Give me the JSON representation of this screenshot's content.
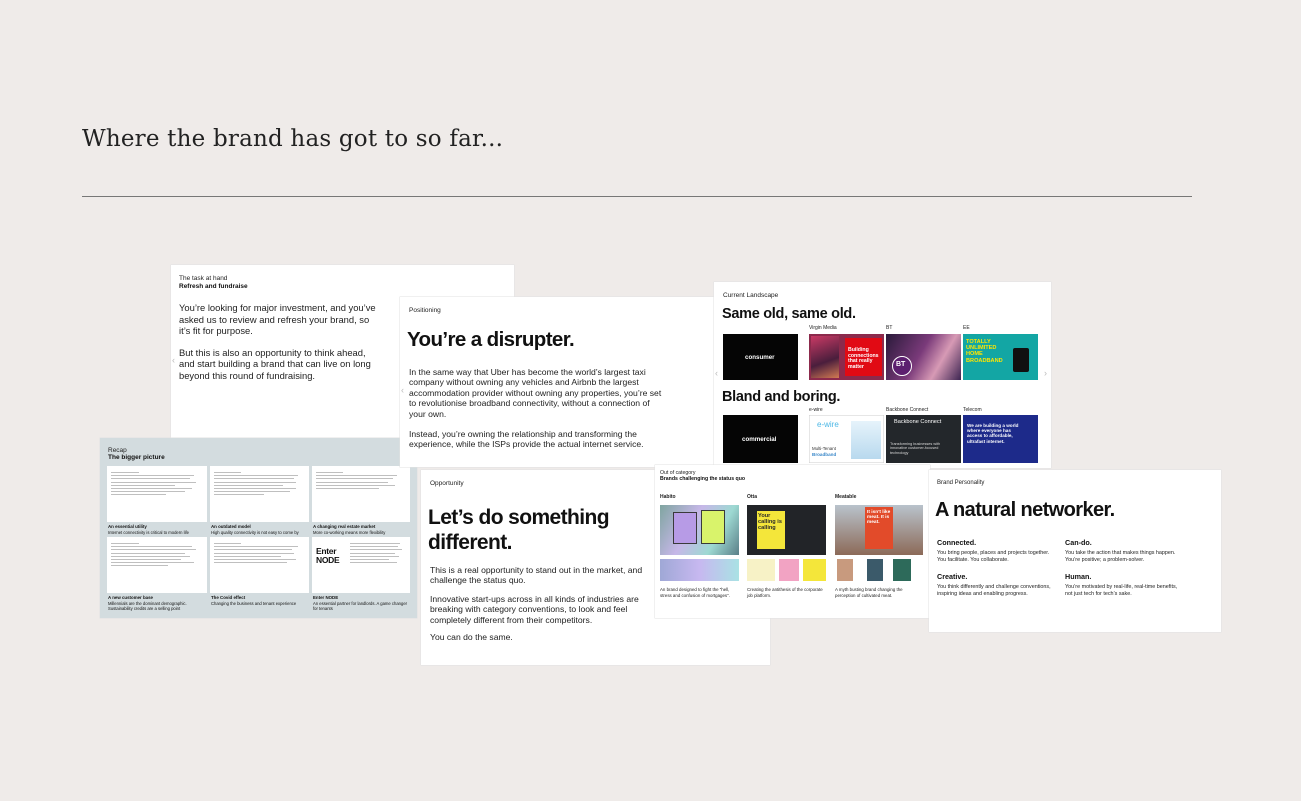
{
  "page": {
    "title": "Where the brand has got to so far..."
  },
  "slides": {
    "task": {
      "label": "The task at hand",
      "title": "Refresh and fundraise",
      "p1": "You’re looking for major investment, and you’ve asked us to review and refresh your brand, so it’s fit for purpose.",
      "p2": "But this is also an opportunity to think ahead, and start building a brand that can live on long beyond this round of fundraising."
    },
    "positioning": {
      "label": "Positioning",
      "heading": "You’re a disrupter.",
      "p1": "In the same way that Uber has become the world’s largest taxi company without owning any vehicles and Airbnb the largest accommodation provider without owning any properties, you’re set to revolutionise broadband connectivity, without a connection of your own.",
      "p2": "Instead, you’re owning the relationship and transforming the experience, while the ISPs provide the actual internet service."
    },
    "landscape": {
      "label": "Current Landscape",
      "heading1": "Same old, same old.",
      "heading2": "Bland and boring.",
      "consumer": "consumer",
      "commercial": "commercial",
      "row1": [
        "Virgin Media",
        "BT",
        "EE"
      ],
      "row2": [
        "e-wire",
        "Backbone Connect",
        "Telecom"
      ],
      "virgin_text": "Building connections that really matter",
      "bt_logo": "BT",
      "ee_text": "TOTALLY UNLIMITED HOME BROADBAND",
      "ewire_logo": "e-wire",
      "ewire_sub1": "Multi-Tenant",
      "ewire_sub2": "Broadband",
      "backbone_logo": "Backbone Connect",
      "backbone_text": "Transforming businesses with innovative customer-focused technology",
      "telecom_text": "We are building a world where everyone has access to affordable, ultrafast internet."
    },
    "recap": {
      "label": "Recap",
      "title": "The bigger picture",
      "captions": [
        {
          "title": "An essential utility",
          "text": "Internet connectivity is critical to modern life"
        },
        {
          "title": "An outdated model",
          "text": "High quality connectivity is not easy to come by"
        },
        {
          "title": "A changing real estate market",
          "text": "More co-working means more flexibility"
        },
        {
          "title": "A new customer base",
          "text": "Millennials are the dominant demographic. Sustainability credits are a selling point"
        },
        {
          "title": "The Covid effect",
          "text": "Changing the business and tenant experience"
        },
        {
          "title": "Enter NODE",
          "text": "An essential partner for landlords. A game changer for tenants"
        }
      ],
      "enter_node": "Enter NODE"
    },
    "opportunity": {
      "label": "Opportunity",
      "heading": "Let’s do something different.",
      "p1": "This is a real opportunity to stand out in the market, and challenge the status quo.",
      "p2": "Innovative start-ups across in all kinds of industries are breaking with category conventions, to look and feel completely different from their competitors.",
      "p3": "You can do the same."
    },
    "category": {
      "label": "Out of category",
      "title": "Brands challenging the status quo",
      "brands": [
        "Habito",
        "Otta",
        "Meatable"
      ],
      "captions": [
        "An brand designed to fight the “hell, stress and confusion of mortgages”.",
        "Creating the antithesis of the corporate job platform.",
        "A myth busting brand changing the perception of cultivated meat."
      ],
      "otta_ad": "Your calling is calling",
      "meat_ad": "It isn't like meat. It is meat."
    },
    "personality": {
      "label": "Brand Personality",
      "heading": "A natural networker.",
      "traits": [
        {
          "title": "Connected.",
          "text": "You bring people, places and projects together. You facilitate. You collaborate."
        },
        {
          "title": "Can-do.",
          "text": "You take the action that makes things happen. You’re positive; a problem-solver."
        },
        {
          "title": "Creative.",
          "text": "You think differently and challenge conventions, inspiring ideas and enabling progress."
        },
        {
          "title": "Human.",
          "text": "You’re motivated by real-life, real-time benefits, not just tech for tech’s sake."
        }
      ]
    }
  },
  "colors": {
    "background": "#efebe9",
    "recap_bg": "#d3dcdf",
    "virgin_red": "#e10a14",
    "ee_teal": "#13a6a4",
    "telecom_blue": "#1d2a8a",
    "backbone_dark": "#23272b",
    "habito_purple": "#b79be6",
    "otta_yellow": "#f4e63a"
  }
}
